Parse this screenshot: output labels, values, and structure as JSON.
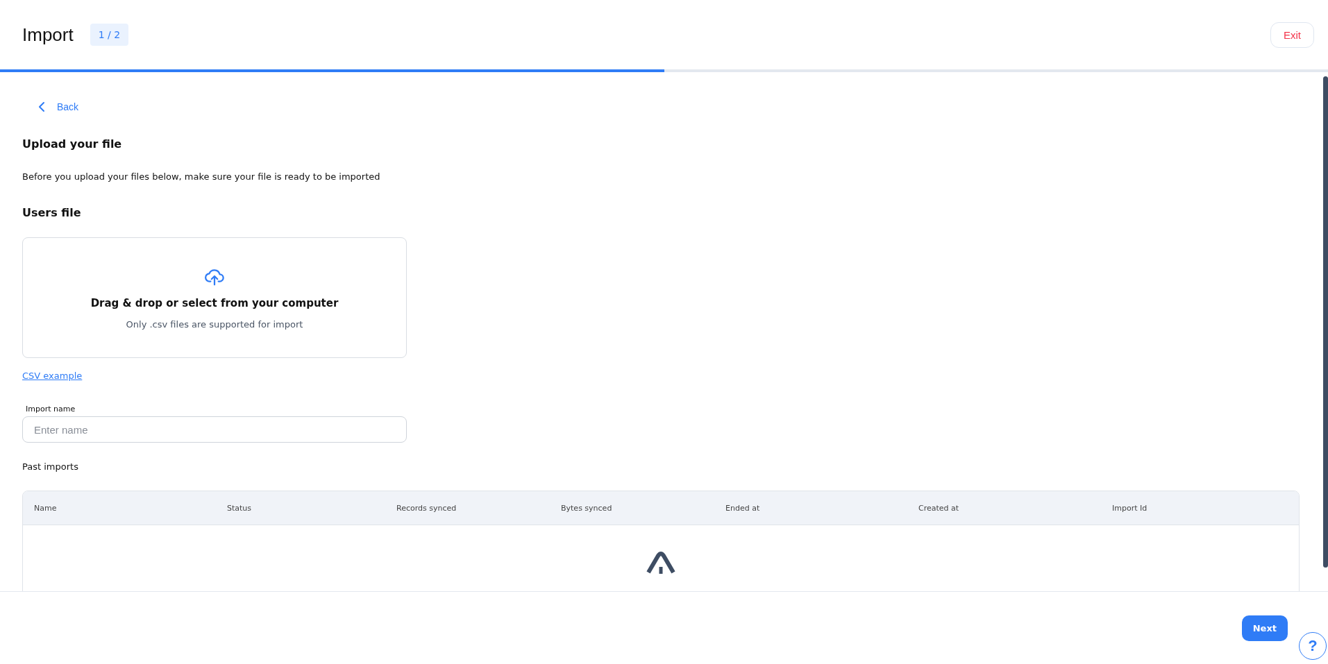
{
  "header": {
    "title": "Import",
    "step_badge": "1 / 2",
    "exit_button": "Exit"
  },
  "progress": {
    "level": 0.5
  },
  "back_link": "Back",
  "section_title": "Upload your file",
  "description": "Before you upload your files below, make sure your file is ready to be imported",
  "file_label": "Users file",
  "dropzone": {
    "title": "Drag & drop or select from your computer",
    "hint": "Only .csv files are supported for import"
  },
  "csv_example_link": "CSV example",
  "import_name": {
    "label": "Import name",
    "placeholder": "Enter name"
  },
  "past_imports": {
    "title": "Past imports",
    "columns": [
      "Name",
      "Status",
      "Records synced",
      "Bytes synced",
      "Ended at",
      "Created at",
      "Import Id"
    ]
  },
  "footer": {
    "next_button": "Next",
    "help_button": "?"
  }
}
